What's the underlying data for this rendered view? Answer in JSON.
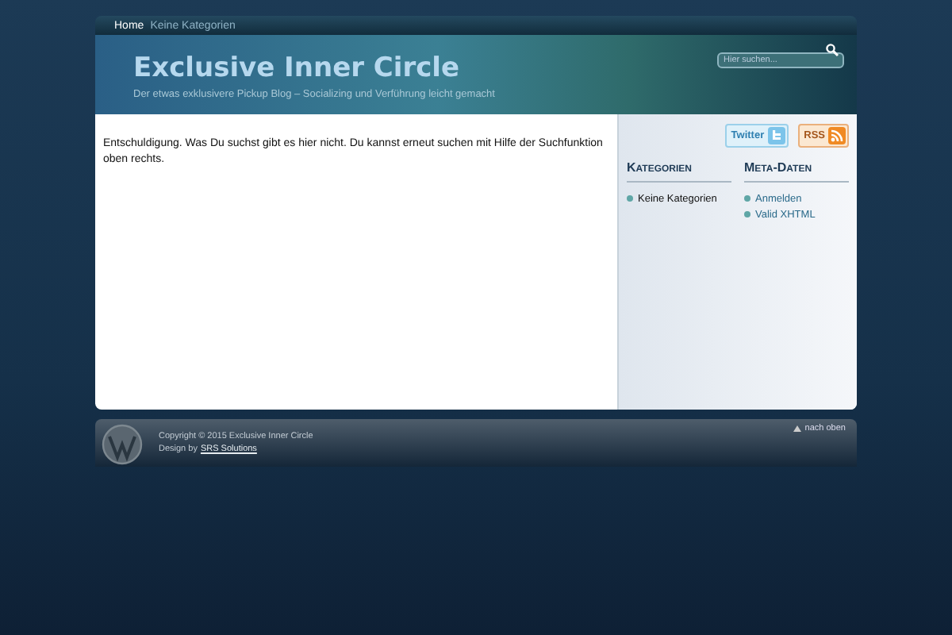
{
  "nav": [
    {
      "label": "Home",
      "selected": true
    },
    {
      "label": "Keine Kategorien",
      "selected": false
    }
  ],
  "header": {
    "title": "Exclusive Inner Circle",
    "tagline": "Der etwas exklusivere Pickup Blog – Socializing und Verführung leicht gemacht",
    "search": {
      "placeholder": "Hier suchen..."
    }
  },
  "content": {
    "message": "Entschuldigung. Was Du suchst gibt es hier nicht. Du kannst erneut suchen mit Hilfe der Suchfunktion oben rechts."
  },
  "sidebar": {
    "feeds": [
      {
        "label": "Twitter",
        "kind": "twitter"
      },
      {
        "label": "RSS",
        "kind": "rss"
      }
    ],
    "widgets": [
      {
        "title": "Kategorien",
        "items": [
          "Keine Kategorien"
        ]
      },
      {
        "title": "Meta-Daten",
        "items": [
          "Anmelden",
          "Valid XHTML"
        ]
      }
    ]
  },
  "footer": {
    "copyright": "Copyright © 2015 Exclusive Inner Circle",
    "design_label": "Design by",
    "design_link": "SRS Solutions",
    "top_link": "nach oben"
  }
}
